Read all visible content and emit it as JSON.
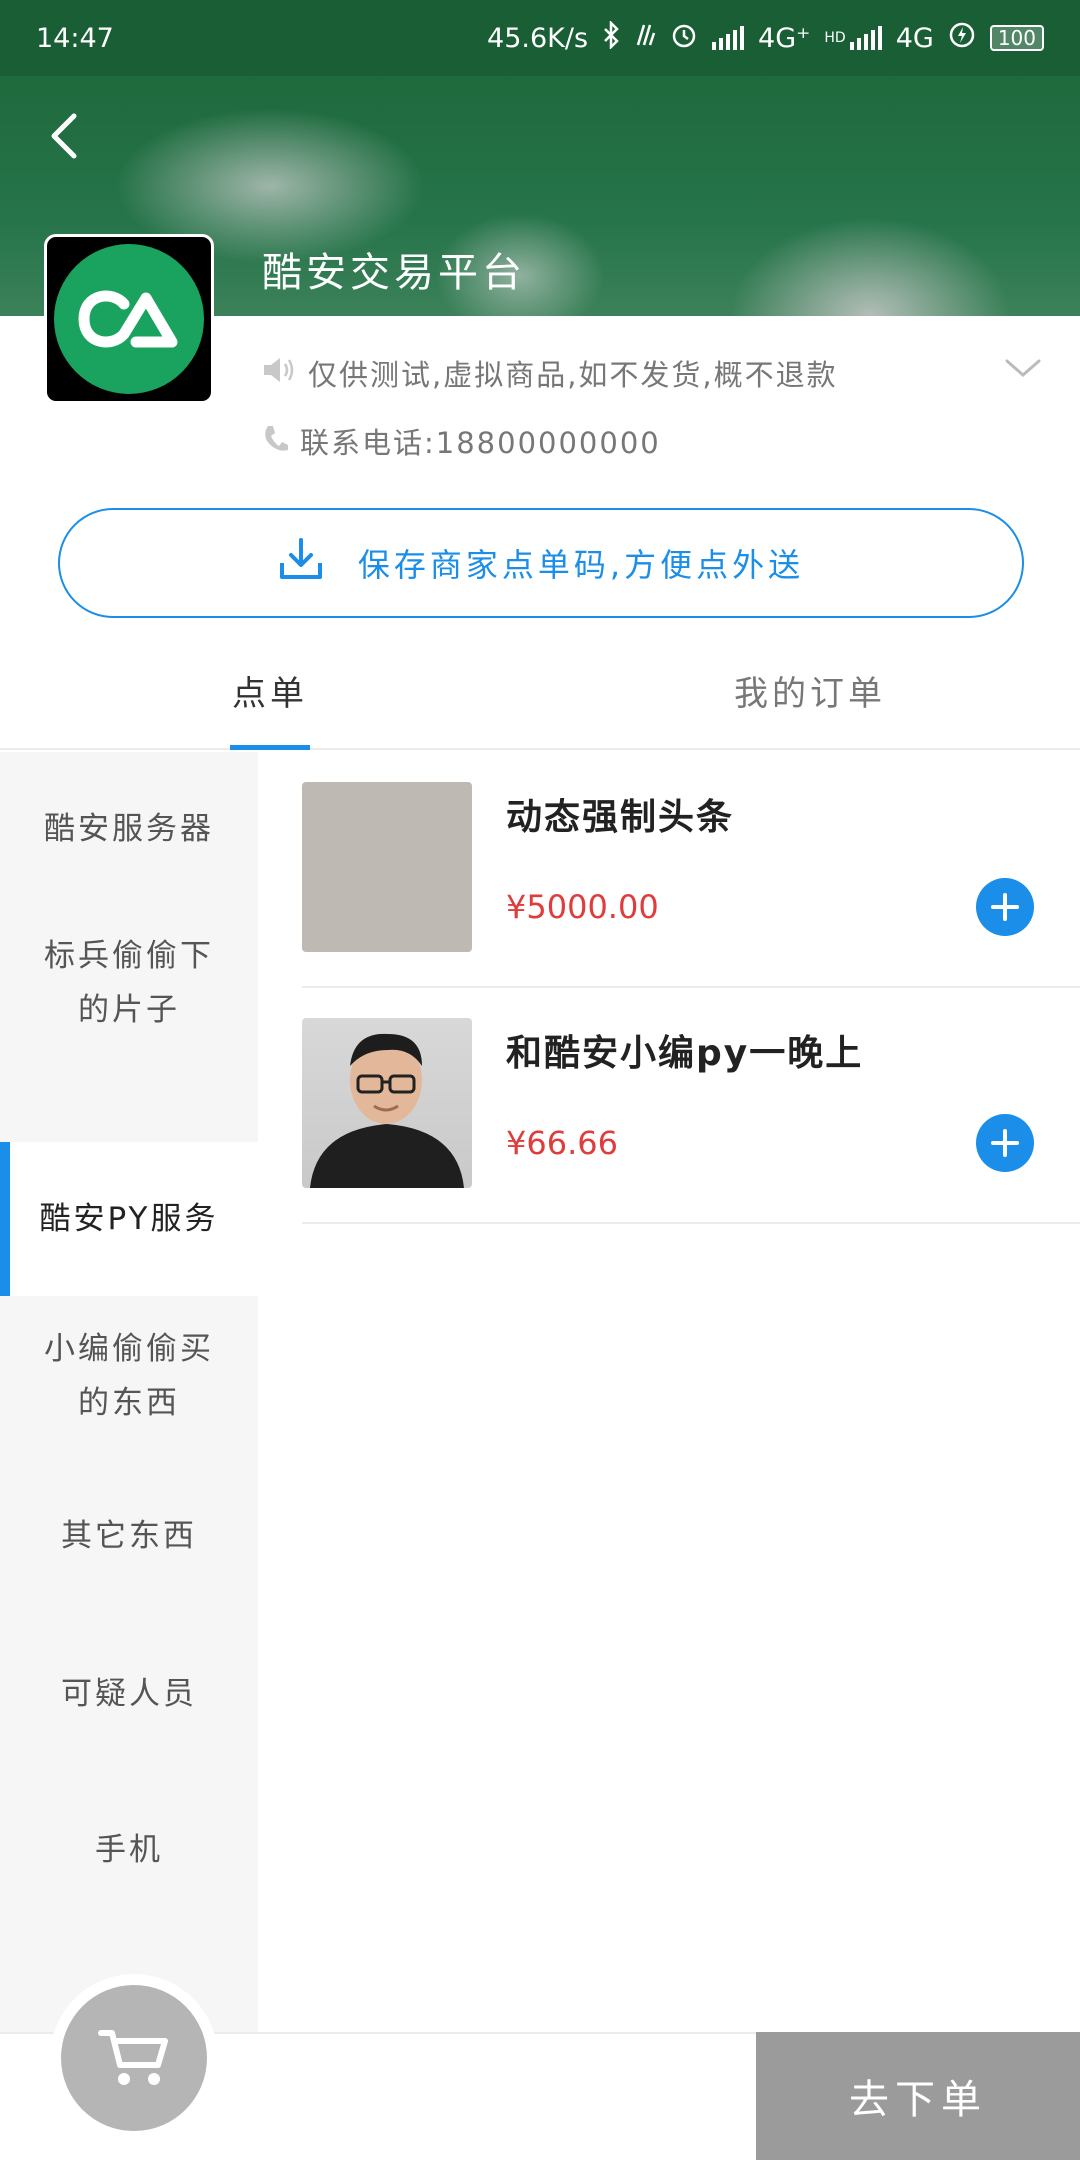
{
  "status_bar": {
    "time": "14:47",
    "net_speed": "45.6K/s",
    "network_1": "4G⁺",
    "hd_label": "HD",
    "network_2": "4G",
    "battery": "100"
  },
  "shop": {
    "name": "酷安交易平台",
    "notice": "仅供测试,虚拟商品,如不发货,概不退款",
    "phone": "联系电话:18800000000",
    "save_qr_label": "保存商家点单码,方便点外送"
  },
  "tabs": {
    "order": "点单",
    "my_orders": "我的订单"
  },
  "categories": [
    {
      "label": "酷安服务器"
    },
    {
      "label": "标兵偷偷下的片子"
    },
    {
      "label": "酷安PY服务"
    },
    {
      "label": "小编偷偷买的东西"
    },
    {
      "label": "其它东西"
    },
    {
      "label": "可疑人员"
    },
    {
      "label": "手机"
    }
  ],
  "active_category": "酷安PY服务",
  "products": [
    {
      "name": "动态强制头条",
      "price": "¥5000.00"
    },
    {
      "name": "和酷安小编py一晚上",
      "price": "¥66.66"
    }
  ],
  "checkout": {
    "label": "去下单"
  },
  "colors": {
    "accent": "#1a8ee8",
    "price": "#e03c3c",
    "status_bar": "#1a5e35",
    "logo_green": "#19a35e"
  }
}
